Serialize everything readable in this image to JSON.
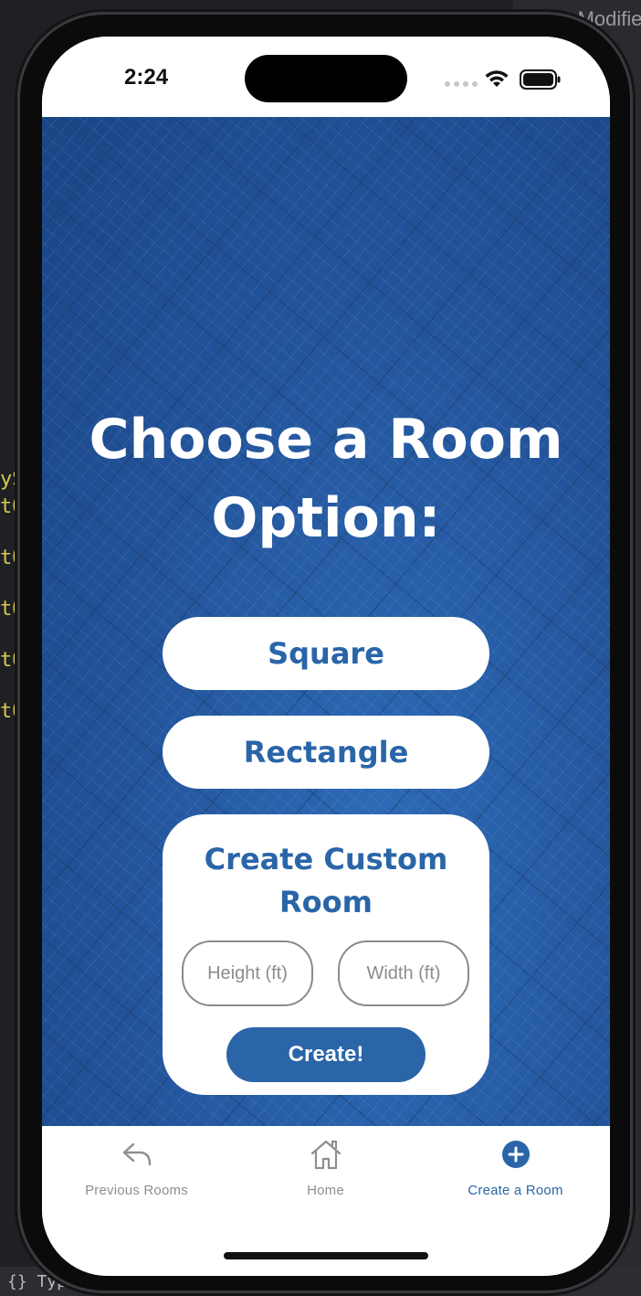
{
  "background": {
    "header_text": "Date Modifie",
    "code_fragments": [
      "ySe",
      "tOu",
      "tOu",
      "tOu",
      "tOu",
      "tOu"
    ],
    "status_fragment": "{}  TypeScript JSX"
  },
  "status_bar": {
    "time": "2:24",
    "icons": [
      "cellular-dots-icon",
      "wifi-icon",
      "battery-icon"
    ]
  },
  "main": {
    "title": "Choose a Room Option:",
    "options": {
      "square_label": "Square",
      "rectangle_label": "Rectangle"
    },
    "custom_room": {
      "title": "Create Custom Room",
      "height_placeholder": "Height (ft)",
      "width_placeholder": "Width (ft)",
      "create_label": "Create!"
    }
  },
  "tab_bar": {
    "tabs": [
      {
        "label": "Previous Rooms",
        "icon": "reply-arrow-icon",
        "active": false
      },
      {
        "label": "Home",
        "icon": "home-icon",
        "active": false
      },
      {
        "label": "Create a Room",
        "icon": "plus-circle-icon",
        "active": true
      }
    ]
  },
  "colors": {
    "accent": "#2a65a8",
    "blueprint": "#2459a0",
    "inactive_tab": "#8e8e93"
  }
}
